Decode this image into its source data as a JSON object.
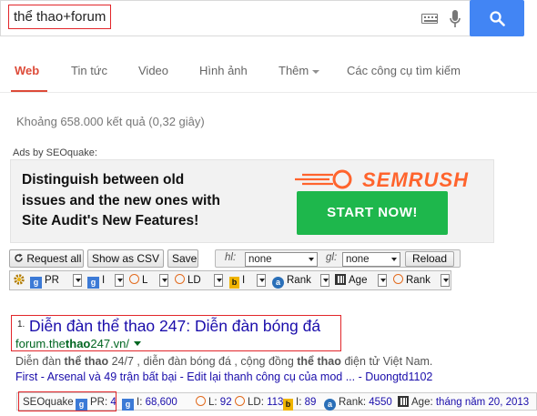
{
  "search": {
    "query": "thể thao+forum"
  },
  "tabs": [
    {
      "label": "Web",
      "active": true
    },
    {
      "label": "Tin tức",
      "active": false
    },
    {
      "label": "Video",
      "active": false
    },
    {
      "label": "Hình ảnh",
      "active": false
    },
    {
      "label": "Thêm",
      "active": false,
      "has_dropdown": true
    },
    {
      "label": "Các công cụ tìm kiếm",
      "active": false
    }
  ],
  "result_stats": "Khoảng 658.000 kết quả (0,32 giây)",
  "ads_by": "Ads by SEOquake:",
  "ad": {
    "line1": "Distinguish between old",
    "line2": "issues and the new ones with",
    "line3": "Site Audit's New Features!",
    "brand": "SEMRUSH",
    "cta": "START NOW!",
    "cta_color": "#1eb74c",
    "brand_color": "#ff642d"
  },
  "toolbar": {
    "request_all": "Request all",
    "show_csv": "Show as CSV",
    "save": "Save",
    "hl_label": "hl:",
    "hl_value": "none",
    "gl_label": "gl:",
    "gl_value": "none",
    "reload": "Reload"
  },
  "params": [
    {
      "icon": "google-g",
      "label": "PR"
    },
    {
      "icon": "google-g",
      "label": "I"
    },
    {
      "icon": "orange-circle",
      "label": "L"
    },
    {
      "icon": "orange-circle",
      "label": "LD"
    },
    {
      "icon": "bing-b",
      "label": "I"
    },
    {
      "icon": "alexa-a",
      "label": "Rank"
    },
    {
      "icon": "calendar",
      "label": "Age"
    },
    {
      "icon": "orange-circle",
      "label": "Rank"
    }
  ],
  "result": {
    "number": "1.",
    "title": "Diễn đàn thể thao 247: Diễn đàn bóng đá",
    "url_pre": "forum.the",
    "url_bold": "thao",
    "url_post": "247.vn/",
    "snippet_pre": "Diễn đàn ",
    "snippet_bold1": "thể thao",
    "snippet_mid": " 24/7 , diễn đàn bóng đá , cộng đồng ",
    "snippet_bold2": "thể thao",
    "snippet_post": " điện tử Việt Nam.",
    "sitelinks": "First - Arsenal và 49 trận bất bại - Edit lại thanh công cụ của mod ... - Duongtd1102"
  },
  "seobar": {
    "brand": "SEOquake",
    "pr_label": "PR: ",
    "pr_value": "4",
    "i_label": "I: ",
    "i_value": "68,600",
    "l_label": "L: ",
    "l_value": "92",
    "ld_label": "LD: ",
    "ld_value": "113",
    "bi_label": "I: ",
    "bi_value": "89",
    "rank_label": "Rank: ",
    "rank_value": "4550",
    "age_label": "Age: ",
    "age_value": "tháng năm 20, 2013"
  }
}
